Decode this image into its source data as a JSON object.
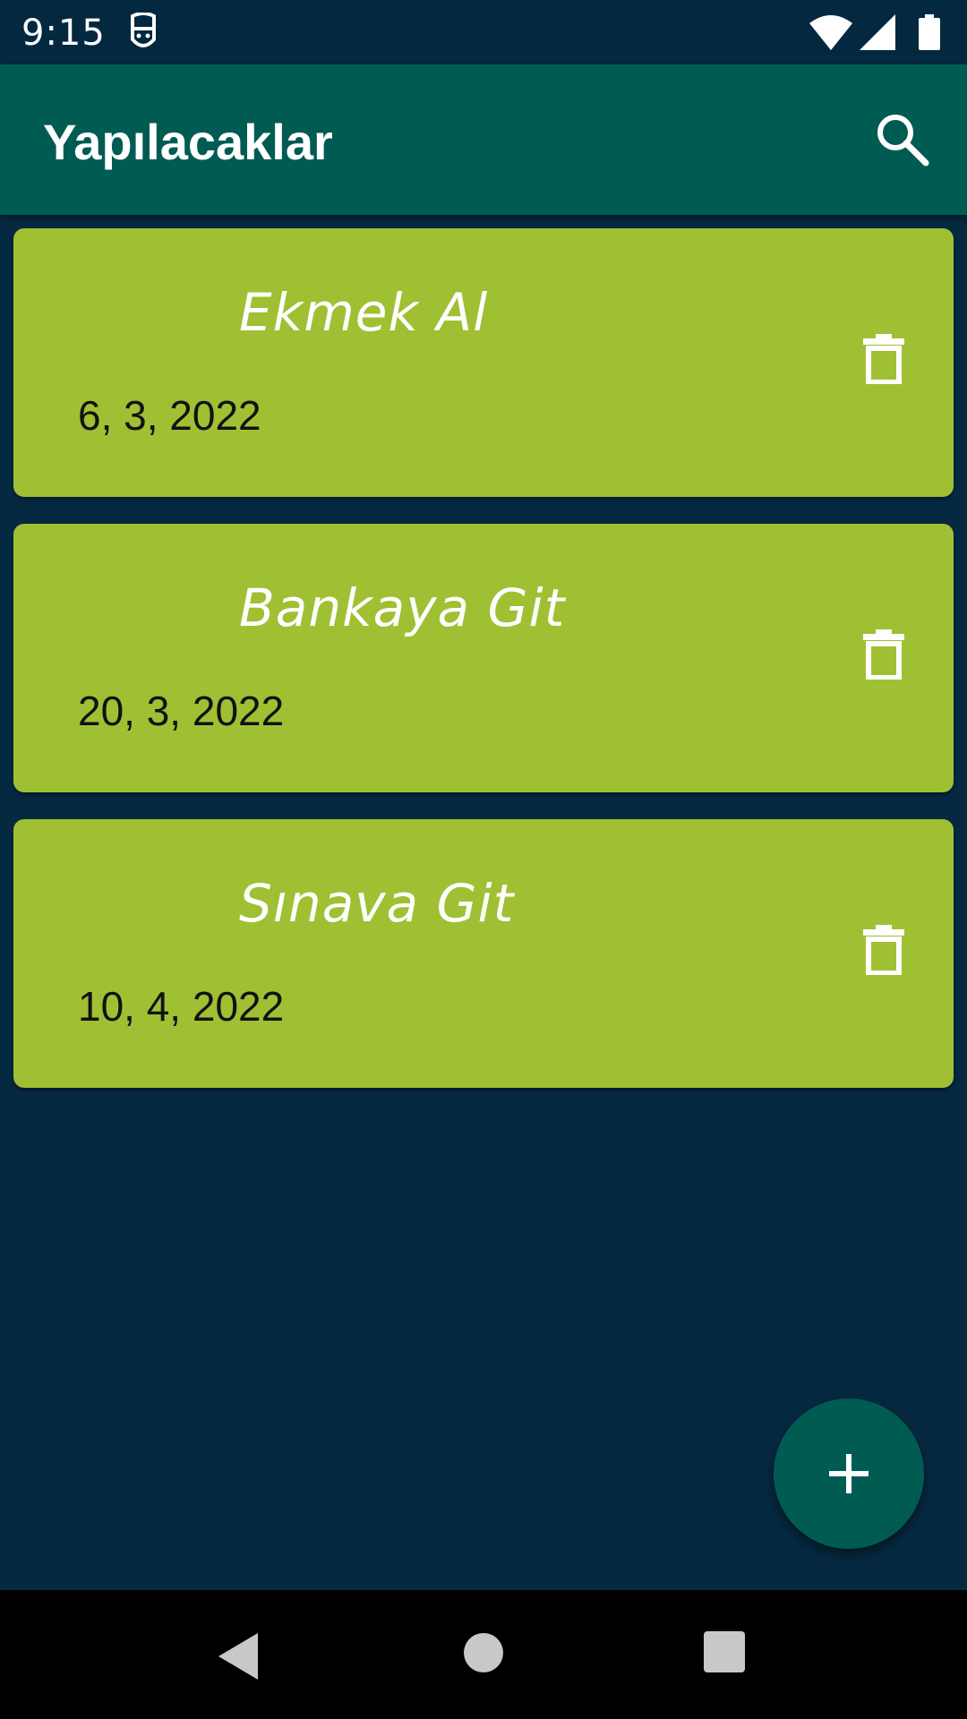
{
  "status_bar": {
    "time": "9:15",
    "icons": [
      "app-notification-icon",
      "wifi-icon",
      "signal-icon",
      "battery-icon"
    ]
  },
  "app_bar": {
    "title": "Yapılacaklar",
    "search_icon": "search-icon"
  },
  "todos": [
    {
      "title": "Ekmek Al",
      "date": "6, 3, 2022",
      "action_icon": "delete-icon"
    },
    {
      "title": "Bankaya Git",
      "date": "20, 3, 2022",
      "action_icon": "delete-icon"
    },
    {
      "title": "Sınava Git",
      "date": "10, 4, 2022",
      "action_icon": "delete-icon"
    }
  ],
  "fab": {
    "icon": "plus-icon"
  },
  "nav_bar": {
    "icons": [
      "back-icon",
      "home-icon",
      "recents-icon"
    ]
  },
  "colors": {
    "background": "#062942",
    "app_bar": "#005c53",
    "card": "#a0c033",
    "fab": "#005c53",
    "on_primary": "#ffffff"
  }
}
